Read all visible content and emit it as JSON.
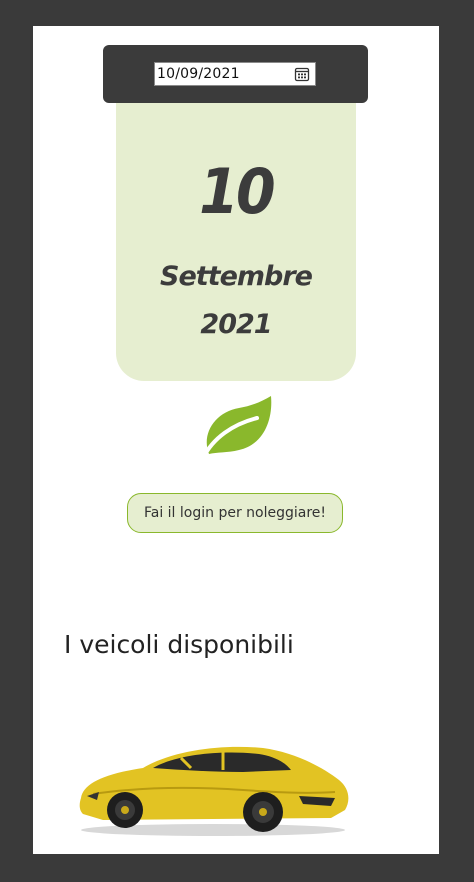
{
  "date_picker": {
    "value": "10/09/2021",
    "icon": "calendar-icon"
  },
  "date_card": {
    "day": "10",
    "month": "Settembre",
    "year": "2021"
  },
  "logo": {
    "icon": "leaf-icon",
    "color": "#8ab82c"
  },
  "login_button": {
    "label": "Fai il login per noleggiare!"
  },
  "vehicles": {
    "title": "I veicoli disponibili",
    "items": [
      {
        "image": "yellow-sports-car-image"
      }
    ]
  },
  "colors": {
    "background": "#3a3a3a",
    "page": "#ffffff",
    "header_bar": "#3b3b3b",
    "card": "#e6eed0",
    "accent": "#8ab82c",
    "text_dark": "#3c3c3c"
  }
}
